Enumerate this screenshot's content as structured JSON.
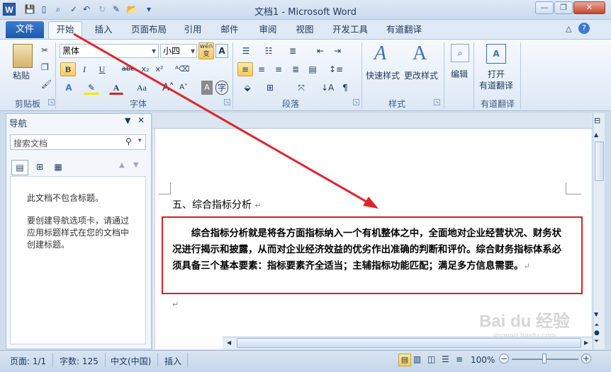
{
  "window": {
    "title": "文档1 - Microsoft Word",
    "app_icon": "W"
  },
  "ribbon_tabs": [
    "文件",
    "开始",
    "插入",
    "页面布局",
    "引用",
    "邮件",
    "审阅",
    "视图",
    "开发工具",
    "有道翻译"
  ],
  "ribbon": {
    "clipboard": {
      "paste": "粘贴",
      "label": "剪贴板"
    },
    "font": {
      "font_name": "黑体",
      "font_size": "小四",
      "phonetic": "wén 变",
      "label": "字体",
      "buttons": [
        "B",
        "I",
        "U",
        "abe",
        "x₂",
        "x²",
        "A",
        "Aa"
      ]
    },
    "paragraph": {
      "label": "段落"
    },
    "styles": {
      "quick_styles": "快速样式",
      "change_styles": "更改样式",
      "label": "样式"
    },
    "editing": {
      "label": "编辑"
    },
    "youdao": {
      "open": "打开",
      "open2": "有道翻译",
      "label": "有道翻译"
    }
  },
  "nav_pane": {
    "title": "导航",
    "search_placeholder": "搜索文档",
    "empty_msg": "此文档不包含标题。",
    "help_msg": "要创建导航选项卡，请通过应用标题样式在您的文档中创建标题。"
  },
  "document": {
    "heading": "五、综合指标分析",
    "paragraph": "综合指标分析就是将各方面指标纳入一个有机整体之中，全面地对企业经营状况、财务状况进行揭示和披露，从而对企业经济效益的优劣作出准确的判断和评价。综合财务指标体系必须具备三个基本要素：指标要素齐全适当；主辅指标功能匹配；满足多方信息需要。",
    "mark": "↵"
  },
  "status": {
    "page": "页面: 1/1",
    "words": "字数: 125",
    "language": "中文(中国)",
    "mode": "插入",
    "zoom": "100%"
  },
  "watermark": {
    "brand": "Bai du 经验",
    "url": "jingyan.baidu.com"
  },
  "colors": {
    "accent": "#2a5ea8",
    "annotation_red": "#d3232a",
    "highlight": "#f8c95a"
  }
}
